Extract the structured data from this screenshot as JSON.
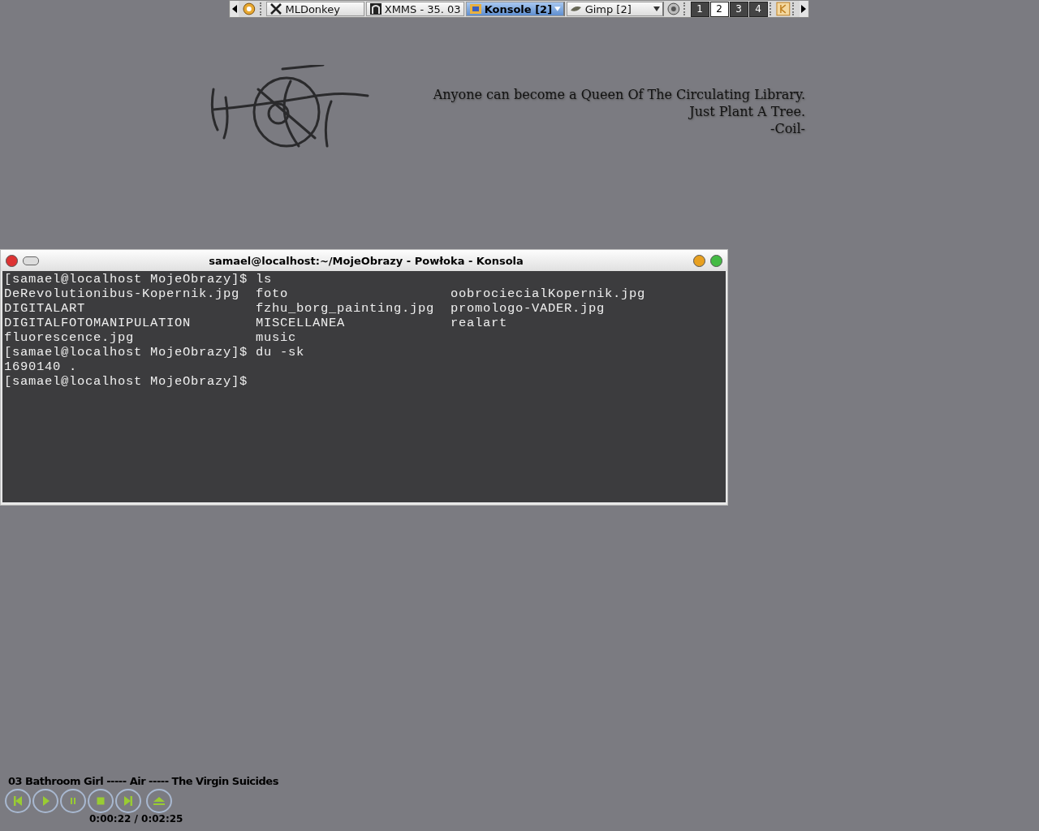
{
  "taskbar": {
    "tasks": [
      {
        "label": "MLDonkey",
        "selected": false,
        "grouped": false
      },
      {
        "label": "XMMS - 35. 03",
        "selected": false,
        "grouped": false
      },
      {
        "label": "Konsole [2]",
        "selected": true,
        "grouped": true
      },
      {
        "label": "Gimp [2]",
        "selected": false,
        "grouped": true
      }
    ],
    "desktops": [
      {
        "label": "1",
        "selected": false
      },
      {
        "label": "2",
        "selected": true
      },
      {
        "label": "3",
        "selected": false
      },
      {
        "label": "4",
        "selected": false
      }
    ]
  },
  "quote": [
    "Anyone can become a Queen Of The Circulating Library.",
    "Just Plant A Tree.",
    "-Coil-"
  ],
  "terminal": {
    "title": "samael@localhost:~/MojeObrazy - Powłoka - Konsola",
    "lines": [
      {
        "kind": "text",
        "text": "[samael@localhost MojeObrazy]$ ls"
      },
      {
        "kind": "columns",
        "cells": [
          "DeRevolutionibus-Kopernik.jpg",
          "foto",
          "oobrociecialKopernik.jpg"
        ]
      },
      {
        "kind": "columns",
        "cells": [
          "DIGITALART",
          "fzhu_borg_painting.jpg",
          "promologo-VADER.jpg"
        ]
      },
      {
        "kind": "columns",
        "cells": [
          "DIGITALFOTOMANIPULATION",
          "MISCELLANEA",
          "realart"
        ]
      },
      {
        "kind": "columns",
        "cells": [
          "fluorescence.jpg",
          "music"
        ]
      },
      {
        "kind": "text",
        "text": "[samael@localhost MojeObrazy]$ du -sk"
      },
      {
        "kind": "text",
        "text": "1690140 ."
      },
      {
        "kind": "text",
        "text": "[samael@localhost MojeObrazy]$"
      }
    ]
  },
  "player": {
    "track": "03 Bathroom Girl ----- Air ----- The Virgin Suicides",
    "time": "0:00:22 / 0:02:25",
    "buttons": [
      {
        "kind": "previous"
      },
      {
        "kind": "play"
      },
      {
        "kind": "pause"
      },
      {
        "kind": "stop"
      },
      {
        "kind": "next"
      },
      {
        "kind": "eject"
      }
    ]
  }
}
